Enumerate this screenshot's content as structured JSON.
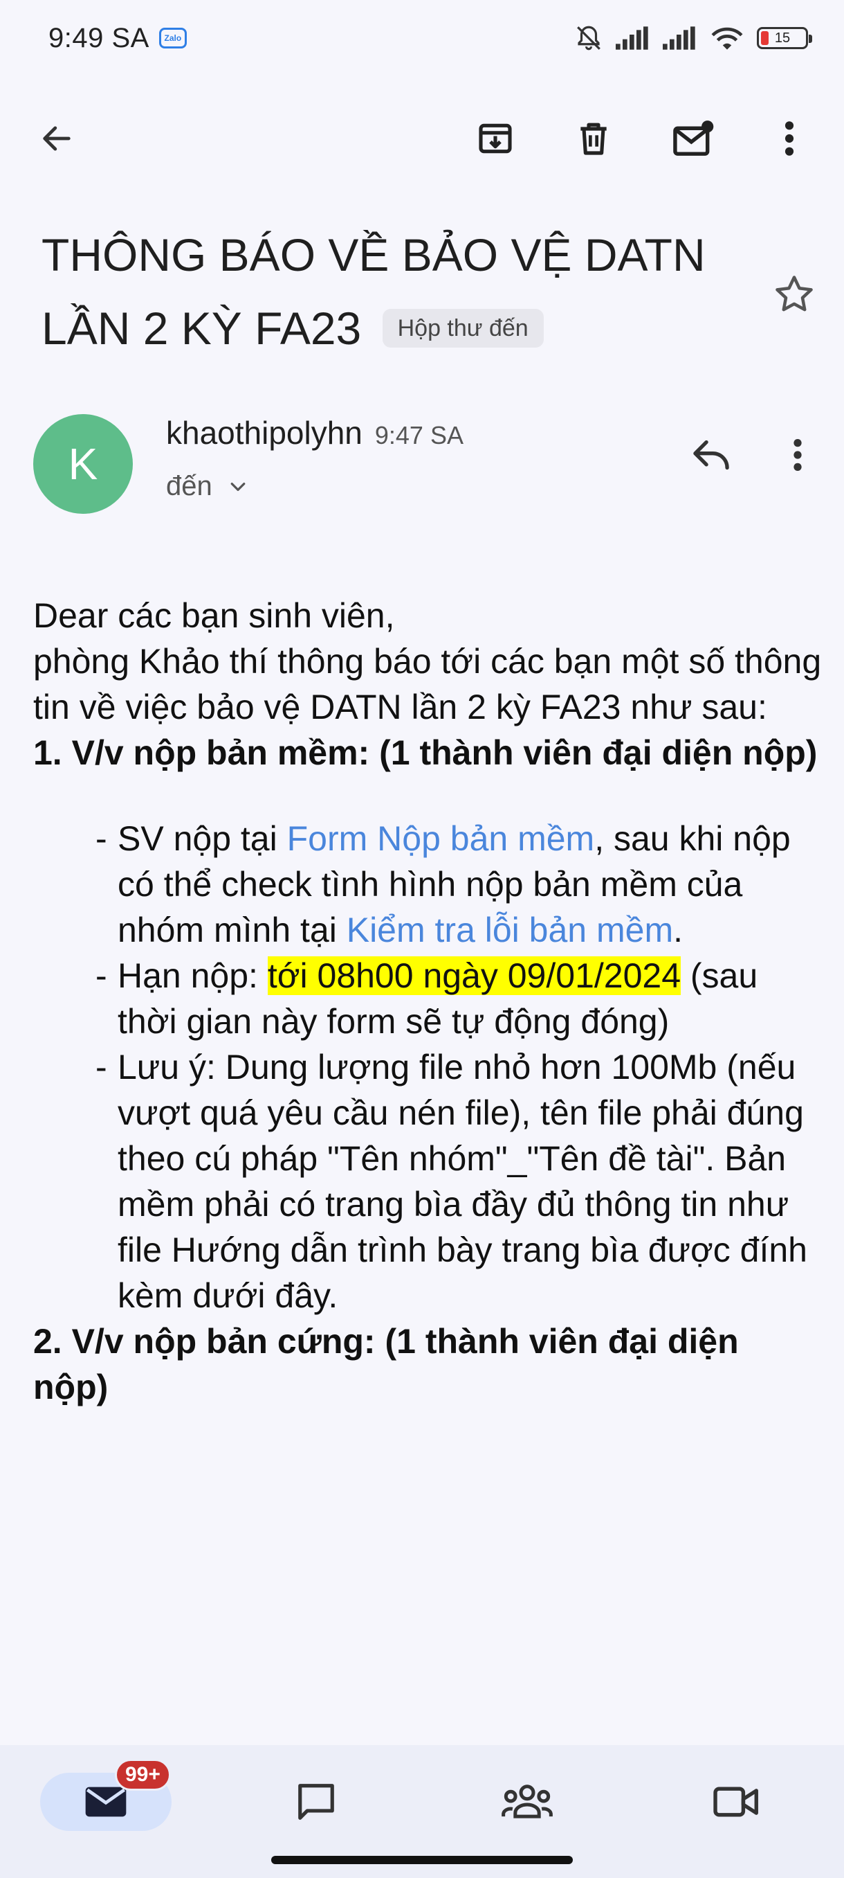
{
  "status_bar": {
    "time": "9:49 SA",
    "zalo_label": "Zalo",
    "battery_level": "15",
    "icons": [
      "zalo-icon",
      "mute-bell-icon",
      "signal-icon",
      "signal-icon",
      "wifi-icon",
      "battery-icon"
    ]
  },
  "toolbar": {
    "icons": [
      "back-arrow-icon",
      "archive-icon",
      "delete-icon",
      "mark-unread-icon",
      "more-vert-icon"
    ]
  },
  "email": {
    "subject": "THÔNG BÁO VỀ BẢO VỆ DATN LẦN 2 KỲ FA23",
    "label": "Hộp thư đến",
    "sender": {
      "initial": "K",
      "name": "khaothipolyhn",
      "time": "9:47 SA",
      "recipient": "đến"
    },
    "body": {
      "greeting": "Dear các bạn sinh viên,",
      "intro": "phòng Khảo thí thông báo tới các bạn một số thông tin về việc bảo vệ DATN lần 2 kỳ FA23 như sau:",
      "section1_heading": "1. V/v nộp bản mềm: (1 thành viên đại diện nộp)",
      "item1_prefix": "SV nộp tại ",
      "item1_link1": "Form Nộp bản mềm",
      "item1_middle": ", sau khi nộp có thể check tình hình nộp bản mềm của nhóm mình tại ",
      "item1_link2": "Kiểm tra lỗi bản mềm",
      "item1_suffix": ".",
      "item2_prefix": "Hạn nộp: ",
      "item2_highlight": "tới 08h00 ngày 09/01/2024",
      "item2_suffix": " (sau thời gian này form sẽ tự động đóng)",
      "item3": "Lưu ý: Dung lượng file nhỏ hơn 100Mb (nếu vượt quá yêu cầu nén file), tên file phải đúng theo cú pháp \"Tên nhóm\"_\"Tên đề tài\". Bản mềm phải có trang bìa đầy đủ thông tin như file Hướng dẫn trình bày trang bìa được đính kèm dưới đây.",
      "section2_heading": "2. V/v nộp bản cứng: (1 thành viên đại diện nộp)"
    }
  },
  "bottom_nav": {
    "mail_badge": "99+",
    "items": [
      "mail-icon",
      "chat-icon",
      "spaces-icon",
      "meet-icon"
    ]
  },
  "colors": {
    "background": "#f6f6fc",
    "avatar": "#5ebd8a",
    "link": "#4a86dc",
    "highlight": "#ffff00",
    "badge": "#c8322e",
    "nav_active": "#d6e2fb"
  }
}
